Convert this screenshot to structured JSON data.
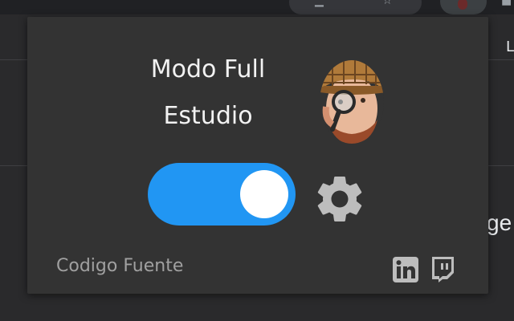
{
  "colors": {
    "popup_bg": "#333333",
    "toggle_on": "#2196f3",
    "text_primary": "#f2f2f2",
    "text_muted": "#a0a0a0",
    "icon_gray": "#bdbdbd"
  },
  "background": {
    "tab_fragment": "L",
    "page_text_fragment": "ge"
  },
  "popup": {
    "title_line1": "Modo Full",
    "title_line2": "Estudio",
    "avatar_icon": "avatar-illustration",
    "toggle": {
      "state": "on",
      "value": 1
    },
    "settings_icon": "gear-icon",
    "footer": {
      "source_link_label": "Codigo Fuente",
      "social_icons": [
        "linkedin-icon",
        "twitch-icon"
      ]
    }
  }
}
